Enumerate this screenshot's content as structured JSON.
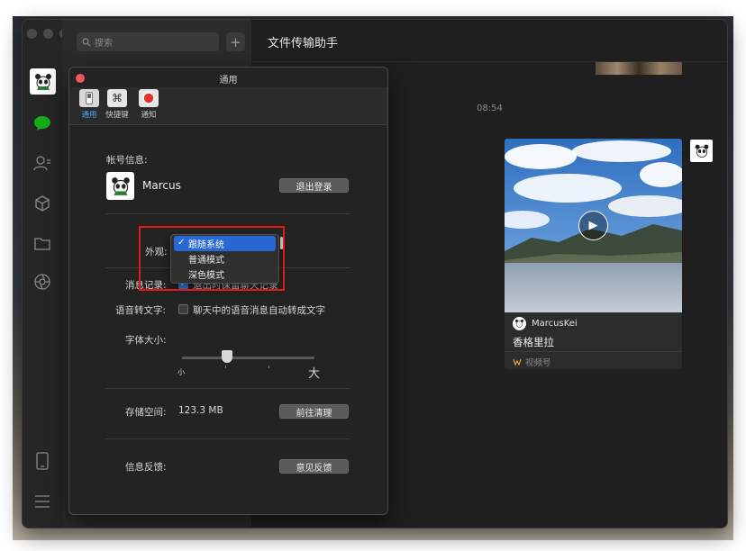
{
  "sidebar": {
    "nav_icons": [
      "chat-bubble-icon",
      "contacts-icon",
      "cube-icon",
      "folder-icon",
      "aperture-icon",
      "phone-icon",
      "menu-icon"
    ]
  },
  "list": {
    "search_placeholder": "搜索",
    "plus": "+"
  },
  "chat": {
    "title": "文件传输助手",
    "timestamp": "08:54",
    "card": {
      "author": "MarcusKei",
      "caption": "香格里拉",
      "source": "视频号"
    }
  },
  "prefs": {
    "window_title": "通用",
    "tabs": [
      {
        "label": "通用",
        "icon": "switch-icon",
        "active": true
      },
      {
        "label": "快捷键",
        "icon": "command-key-icon",
        "active": false
      },
      {
        "label": "通知",
        "icon": "record-icon",
        "active": false
      }
    ],
    "account": {
      "label": "帐号信息:",
      "name": "Marcus",
      "logout_button": "退出登录"
    },
    "appearance": {
      "label": "外观:",
      "options": [
        "跟随系统",
        "普通模式",
        "深色模式"
      ],
      "selected": "跟随系统",
      "check": "✓"
    },
    "history": {
      "label": "消息记录:",
      "option": "退出时保留聊天记录",
      "checked": true
    },
    "voice": {
      "label": "语音转文字:",
      "option": "聊天中的语音消息自动转成文字",
      "checked": false
    },
    "font_size": {
      "label": "字体大小:",
      "min_label": "小",
      "max_label": "大"
    },
    "storage": {
      "label": "存储空间:",
      "value": "123.3 MB",
      "button": "前往清理"
    },
    "feedback": {
      "label": "信息反馈:",
      "button": "意见反馈"
    }
  },
  "colors": {
    "accent": "#2867d6",
    "wechat_green": "#1aad19",
    "highlight_red": "#e01a1a",
    "close_red": "#ed5a55"
  }
}
